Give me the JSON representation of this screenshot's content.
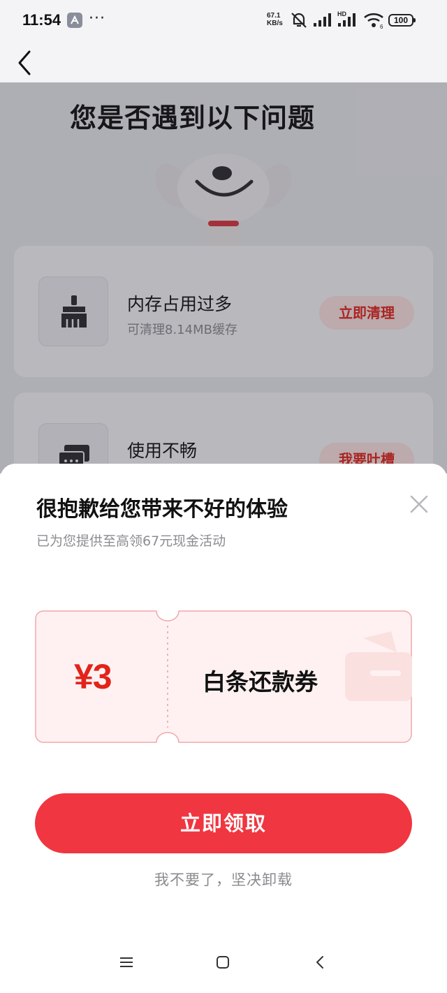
{
  "status_bar": {
    "time": "11:54",
    "more": "···",
    "net_speed_value": "67.1",
    "net_speed_unit": "KB/s",
    "battery": "100"
  },
  "page": {
    "heading": "您是否遇到以下问题",
    "cards": [
      {
        "title": "内存占用过多",
        "subtitle": "可清理8.14MB缓存",
        "button": "立即清理",
        "icon": "broom-icon"
      },
      {
        "title": "使用不畅",
        "button": "我要吐槽",
        "icon": "chat-bubbles-icon"
      }
    ]
  },
  "sheet": {
    "title": "很抱歉给您带来不好的体验",
    "subtitle": "已为您提供至高领67元现金活动",
    "coupon": {
      "amount": "¥3",
      "name": "白条还款券"
    },
    "primary_button": "立即领取",
    "uninstall_link": "我不要了，坚决卸载"
  },
  "colors": {
    "accent": "#e2231a",
    "button": "#f03640",
    "coupon_bg": "#fff1f1",
    "coupon_border": "#f0a8aa"
  }
}
